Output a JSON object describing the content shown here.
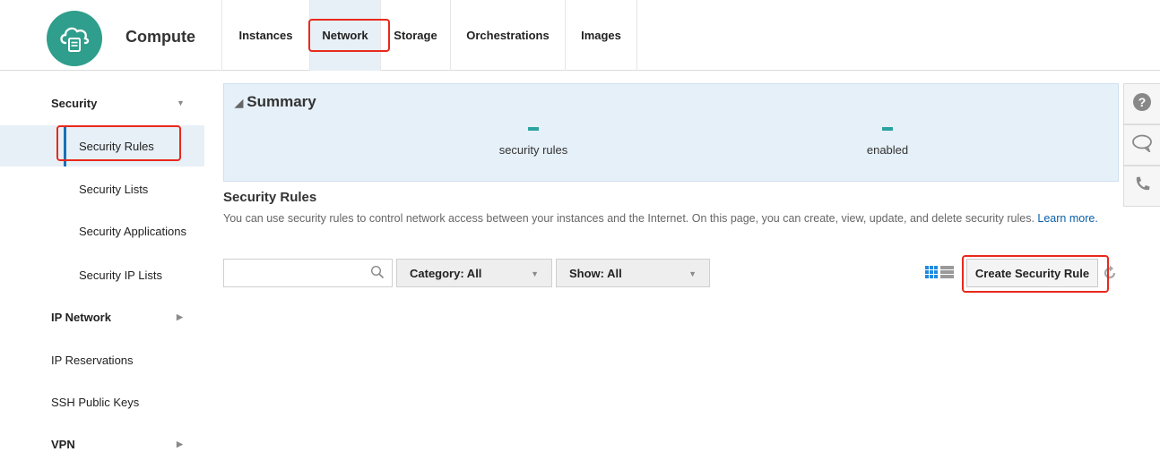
{
  "header": {
    "app_title": "Compute",
    "tabs": [
      {
        "label": "Instances"
      },
      {
        "label": "Network"
      },
      {
        "label": "Storage"
      },
      {
        "label": "Orchestrations"
      },
      {
        "label": "Images"
      }
    ],
    "active_tab": "Network"
  },
  "sidebar": {
    "items": [
      {
        "label": "Security",
        "type": "group",
        "expanded": true
      },
      {
        "label": "Security Rules",
        "type": "sub",
        "selected": true
      },
      {
        "label": "Security Lists",
        "type": "sub"
      },
      {
        "label": "Security Applications",
        "type": "sub"
      },
      {
        "label": "Security IP Lists",
        "type": "sub"
      },
      {
        "label": "IP Network",
        "type": "group",
        "expanded": false
      },
      {
        "label": "IP Reservations",
        "type": "plain"
      },
      {
        "label": "SSH Public Keys",
        "type": "plain"
      },
      {
        "label": "VPN",
        "type": "group",
        "expanded": false
      }
    ]
  },
  "summary": {
    "title": "Summary",
    "stats": [
      {
        "value": "-",
        "label": "security rules"
      },
      {
        "value": "-",
        "label": "enabled"
      }
    ]
  },
  "section": {
    "title": "Security Rules",
    "description": "You can use security rules to control network access between your instances and the Internet. On this page, you can create, view, update, and delete security rules.",
    "learn_more": "Learn more."
  },
  "toolbar": {
    "search_placeholder": "",
    "category_filter": "Category: All",
    "show_filter": "Show: All",
    "create_button": "Create Security Rule"
  },
  "icons": {
    "logo": "cloud-server-icon",
    "search": "magnifier-icon",
    "view_toggle": "grid-list-icon",
    "refresh": "refresh-icon",
    "help": "question-icon",
    "chat": "chat-bubble-icon",
    "phone": "phone-icon"
  },
  "colors": {
    "accent_teal": "#2f9e8c",
    "highlight_red": "#e8291c",
    "link_blue": "#0a5fa8",
    "selected_bg": "#e7f0f7",
    "grid_icon_blue": "#1f8ae0"
  }
}
